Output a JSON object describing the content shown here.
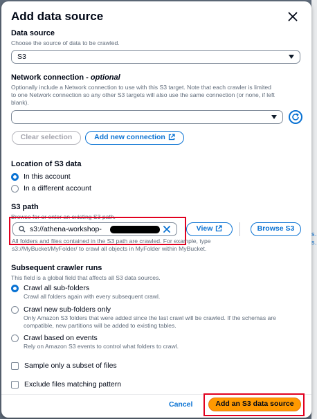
{
  "modal": {
    "title": "Add data source",
    "close_icon": "close-icon"
  },
  "data_source": {
    "label": "Data source",
    "description": "Choose the source of data to be crawled.",
    "selected": "S3"
  },
  "network": {
    "label": "Network connection",
    "label_suffix": "optional",
    "description_line1": "Optionally include a Network connection to use with this S3 target. Note that each crawler is limited",
    "description_line2": "to one Network connection so any other S3 targets will also use the same connection (or none, if left",
    "description_line3": "blank).",
    "selected": "",
    "clear_button": "Clear selection",
    "add_button": "Add new connection"
  },
  "location": {
    "label": "Location of S3 data",
    "options": [
      {
        "label": "In this account",
        "selected": true
      },
      {
        "label": "In a different account",
        "selected": false
      }
    ]
  },
  "s3_path": {
    "label": "S3 path",
    "description": "Browse for or enter an existing S3 path.",
    "value": "s3://athena-workshop-",
    "view_button": "View",
    "browse_button": "Browse S3",
    "hint_line1": "All folders and files contained in the S3 path are crawled. For example, type",
    "hint_line2": "s3://MyBucket/MyFolder/ to crawl all objects in MyFolder within MyBucket."
  },
  "subsequent": {
    "label": "Subsequent crawler runs",
    "description": "This field is a global field that affects all S3 data sources.",
    "options": [
      {
        "label": "Crawl all sub-folders",
        "desc1": "Crawl all folders again with every subsequent crawl.",
        "desc2": "",
        "selected": true
      },
      {
        "label": "Crawl new sub-folders only",
        "desc1": "Only Amazon S3 folders that were added since the last crawl will be crawled. If the schemas are",
        "desc2": "compatible, new partitions will be added to existing tables.",
        "selected": false
      },
      {
        "label": "Crawl based on events",
        "desc1": "Rely on Amazon S3 events to control what folders to crawl.",
        "desc2": "",
        "selected": false
      }
    ]
  },
  "checks": {
    "sample_subset": "Sample only a subset of files",
    "exclude_pattern": "Exclude files matching pattern"
  },
  "footer": {
    "cancel": "Cancel",
    "submit": "Add an S3 data source"
  },
  "backdrop": {
    "link_text": "s…",
    "link_text2": "s…"
  },
  "colors": {
    "accent": "#0972d3",
    "primary": "#ff9900",
    "highlight": "#e1001f"
  }
}
